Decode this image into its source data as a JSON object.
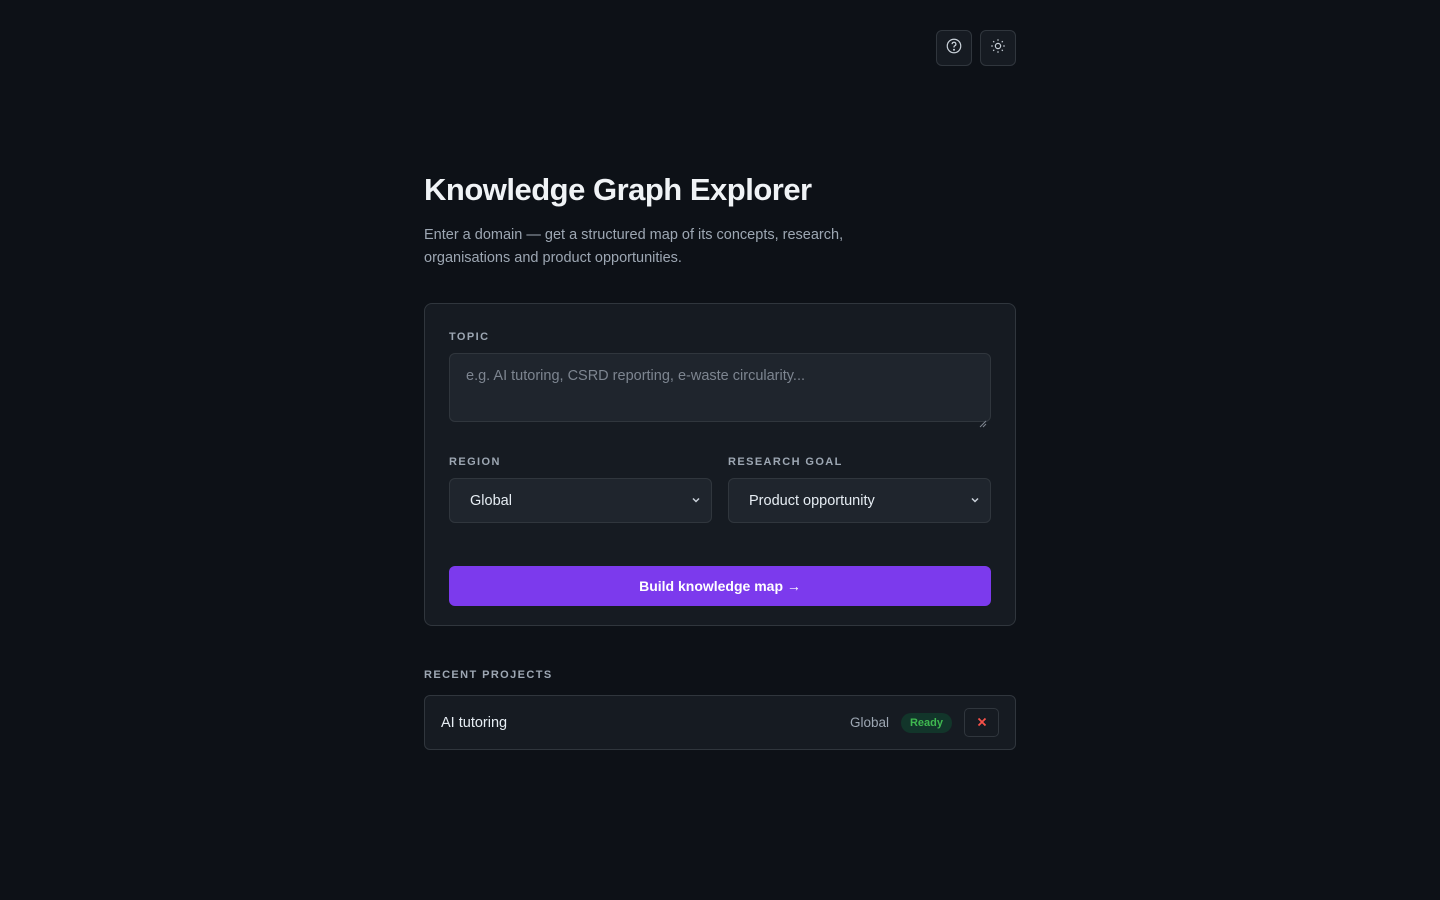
{
  "header": {
    "help_icon": "help-circle-icon",
    "theme_icon": "sun-icon"
  },
  "main": {
    "title": "Knowledge Graph Explorer",
    "subtitle": "Enter a domain — get a structured map of its concepts, research, organisations and product opportunities."
  },
  "form": {
    "topic_label": "TOPIC",
    "topic_placeholder": "e.g. AI tutoring, CSRD reporting, e-waste circularity...",
    "topic_value": "",
    "region_label": "REGION",
    "region_value": "Global",
    "goal_label": "RESEARCH GOAL",
    "goal_value": "Product opportunity",
    "submit_label": "Build knowledge map →"
  },
  "recent": {
    "label": "RECENT PROJECTS",
    "projects": [
      {
        "name": "AI tutoring",
        "region": "Global",
        "status": "Ready"
      }
    ]
  },
  "colors": {
    "background": "#0d1117",
    "card": "#161b22",
    "accent": "#7c3aed",
    "ready_green": "#3fb950",
    "delete_red": "#f85149"
  }
}
